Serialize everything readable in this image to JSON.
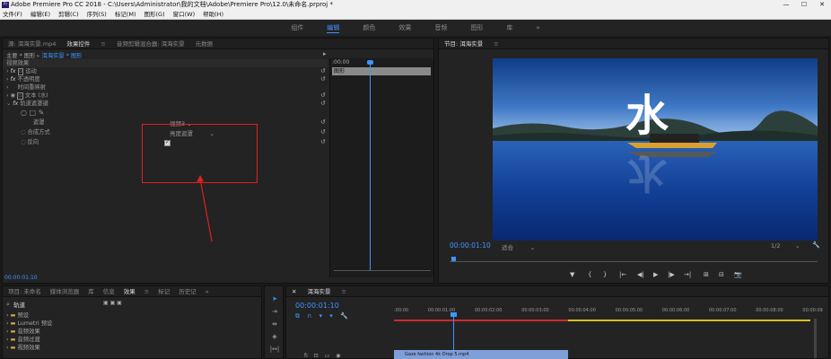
{
  "title_bar": {
    "app_icon": "Pr",
    "title": "Adobe Premiere Pro CC 2018 - C:\\Users\\Administrator\\我的文档\\Adobe\\Premiere Pro\\12.0\\未命名.prproj *",
    "minimize": "—",
    "maximize": "☐",
    "close": "✕"
  },
  "menu": [
    "文件(F)",
    "编辑(E)",
    "剪辑(C)",
    "序列(S)",
    "标记(M)",
    "图形(G)",
    "窗口(W)",
    "帮助(H)"
  ],
  "workspaces": [
    "组件",
    "编辑",
    "颜色",
    "效果",
    "音频",
    "图形",
    "库"
  ],
  "workspace_more": "»",
  "effect_controls": {
    "tabs": [
      "源: 洱海实景.mp4",
      "效果控件",
      "音频剪辑混合器: 洱海实景",
      "元数据"
    ],
    "breadcrumb_main": "主要 * 图形",
    "breadcrumb_seq": "洱海实景 * 图形",
    "section": "视频效果",
    "rows": [
      "运动",
      "不透明度",
      "时间重映射",
      "文本 (水)",
      "轨道遮罩键"
    ],
    "mask_label": "遮罩",
    "mask_value": "视频3",
    "composite_label": "合成方式",
    "composite_value": "亮度遮罩",
    "reverse_label": "反向",
    "timecode": "00:00:01:10",
    "mini_timecode": ":00:00",
    "mini_clip": "图形"
  },
  "program": {
    "title": "节目: 洱海实景",
    "overlay_text": "水",
    "timecode": "00:00:01:10",
    "fit": "适合",
    "scale": "1/2",
    "controls": [
      "▼",
      "{",
      "}",
      "|←",
      "◀|",
      "▶",
      "|▶",
      "→|",
      "⊞",
      "⊟",
      "📷"
    ]
  },
  "effects_panel": {
    "tabs": [
      "项目: 未命名",
      "媒体浏览器",
      "库",
      "信息",
      "效果",
      "标记",
      "历史记"
    ],
    "search": "轨道",
    "folders": [
      "预设",
      "Lumetri 预设",
      "音频效果",
      "音频过渡",
      "视频效果"
    ]
  },
  "timeline": {
    "title": "洱海实景",
    "timecode": "00:00:01:10",
    "ticks": [
      ":00:00",
      "00:00:01:00",
      "00:00:02:00",
      "00:00:03:00",
      "00:00:04:00",
      "00:00:05:00",
      "00:00:06:00",
      "00:00:07:00",
      "00:00:08:00",
      "00:00:09"
    ],
    "clip": "Gaze fashion 4k Drop 5.mp4"
  }
}
